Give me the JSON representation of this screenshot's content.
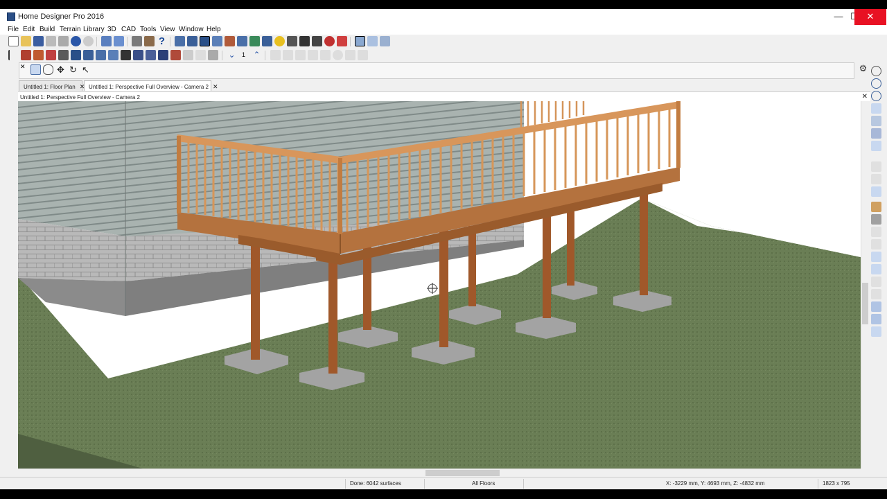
{
  "app": {
    "title": "Home Designer Pro 2016",
    "controls": {
      "minimize": "—",
      "maximize": "☐",
      "close": "✕"
    }
  },
  "menu": [
    "File",
    "Edit",
    "Build",
    "Terrain",
    "Library",
    "3D",
    "CAD",
    "Tools",
    "View",
    "Window",
    "Help"
  ],
  "tabs": [
    {
      "label": "Untitled 1: Floor Plan",
      "active": false
    },
    {
      "label": "Untitled 1: Perspective Full Overview - Camera 2",
      "active": true
    }
  ],
  "view": {
    "label": "Untitled 1: Perspective Full Overview - Camera 2"
  },
  "toolbar2": {
    "floor_number": "1"
  },
  "status": {
    "progress": "Done:  6042 surfaces",
    "floors": "All Floors",
    "coords": "X: -3229 mm, Y: 4693 mm, Z: -4832 mm",
    "size": "1823 x 795"
  },
  "colors": {
    "accent": "#2b5ea8",
    "close": "#e81123",
    "wood": "#c9874c",
    "grass": "#6b7f56"
  }
}
